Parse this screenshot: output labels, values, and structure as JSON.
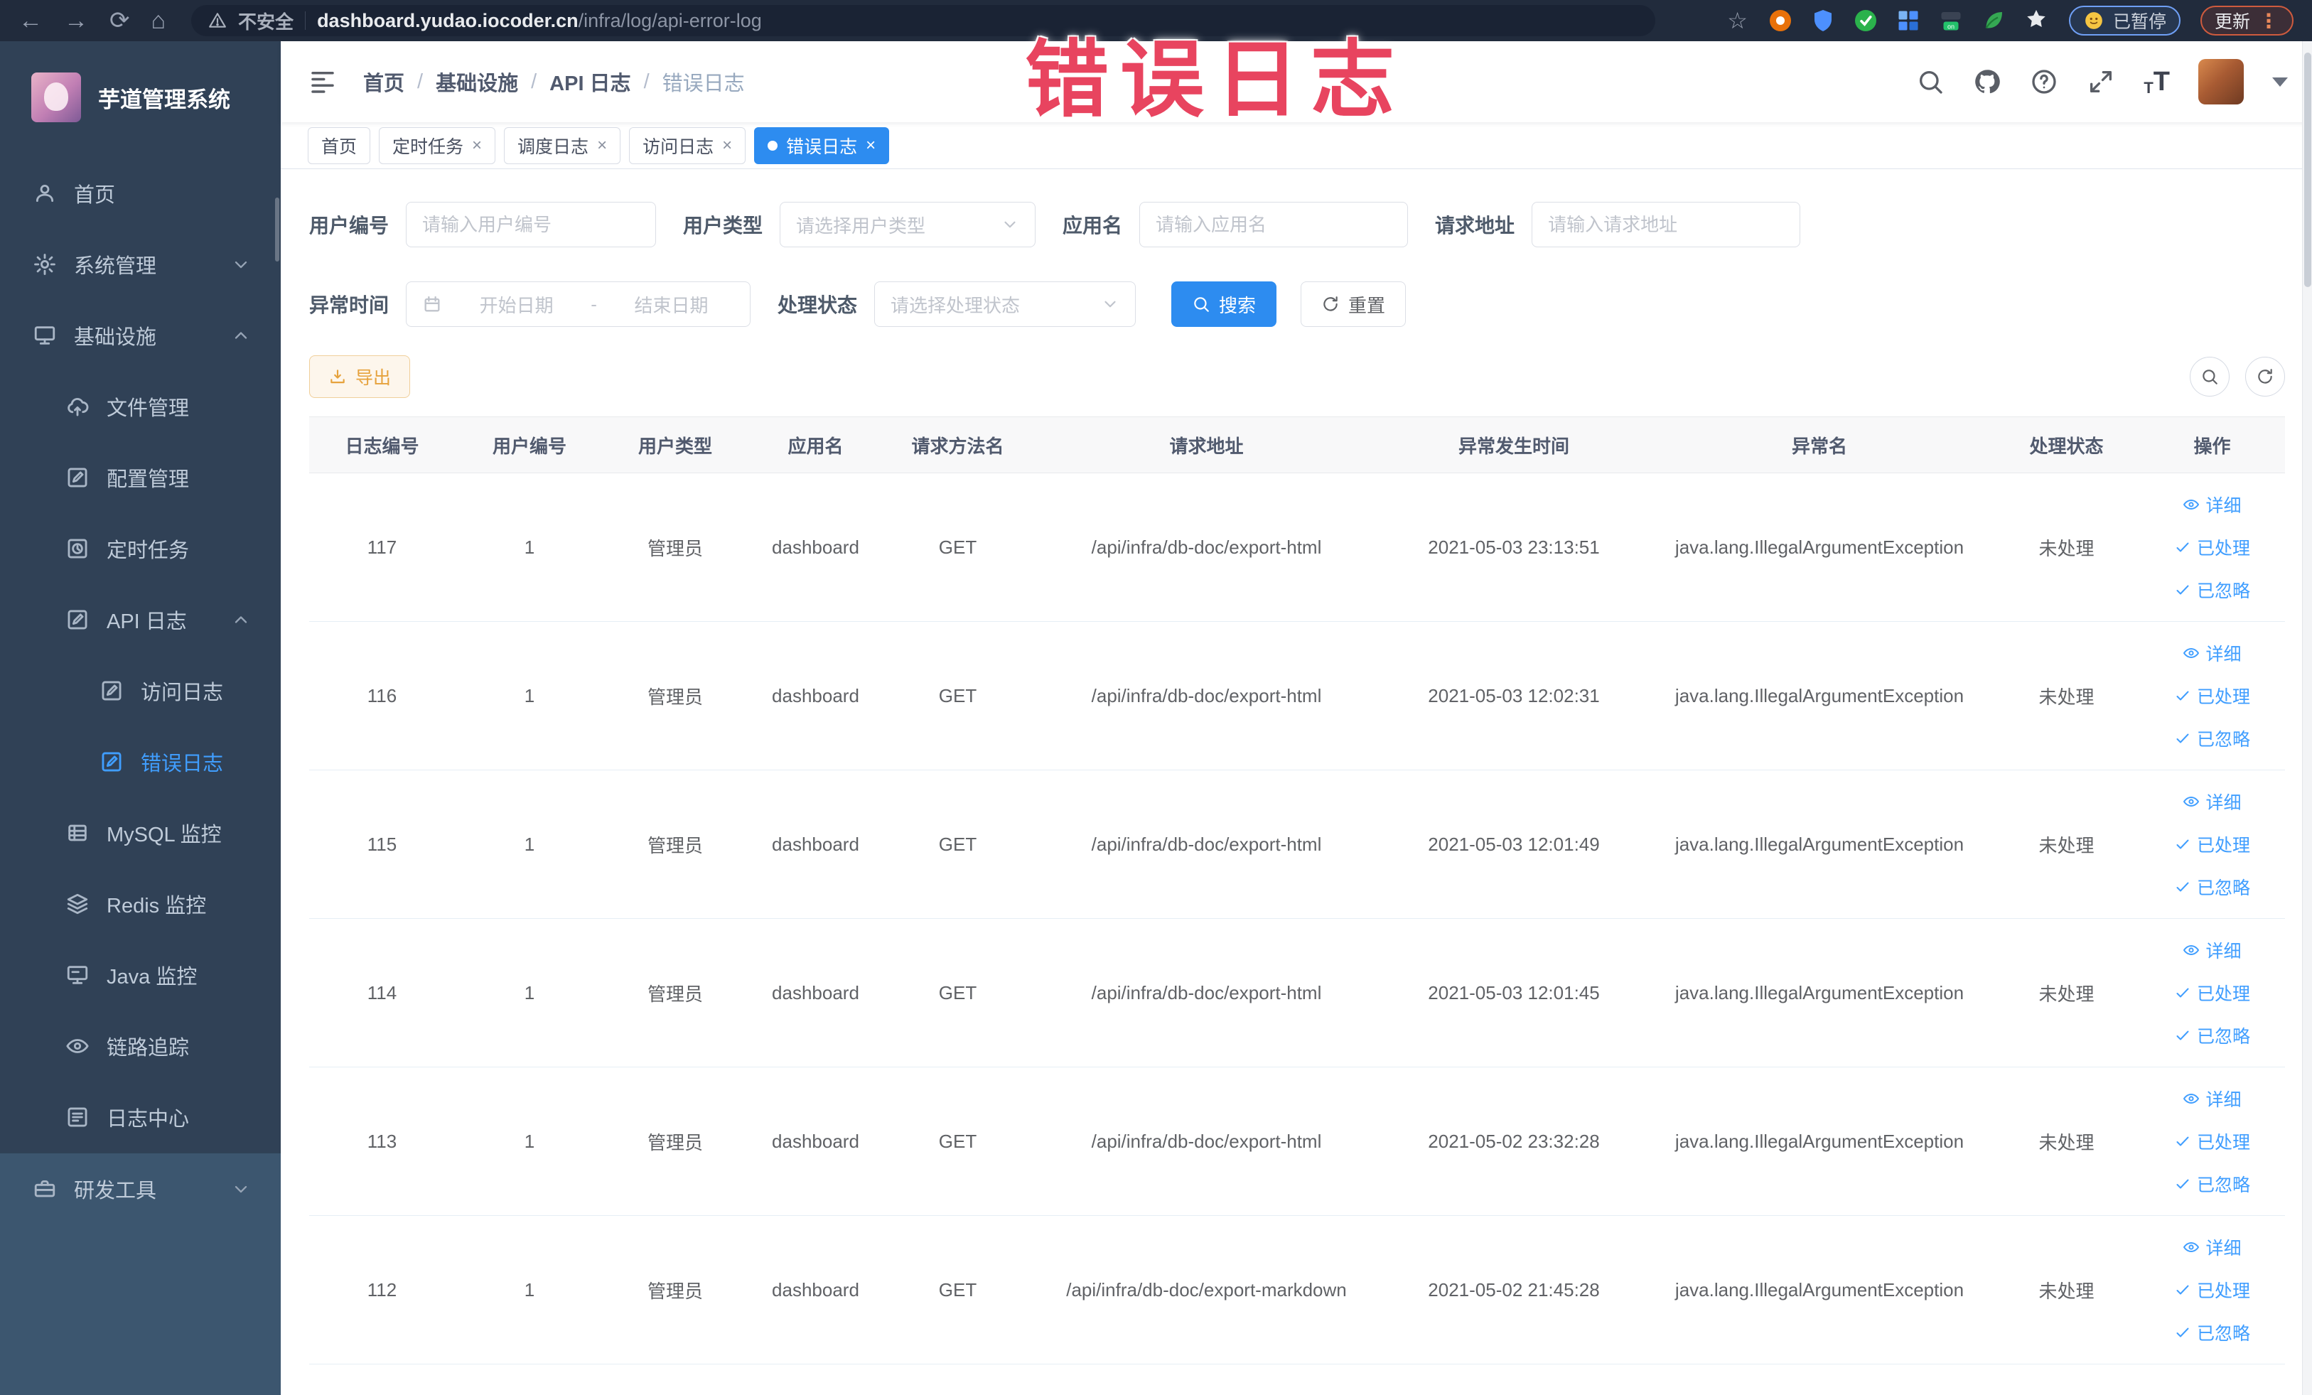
{
  "watermark": "错误日志",
  "colors": {
    "accent": "#409eff",
    "primary_button": "#2d8cf0",
    "warning": "#e6a23c",
    "sidebar_bg": "#304156",
    "watermark_pink": "#e8445f",
    "active_tab": "#2d8cf0"
  },
  "browser": {
    "security_label": "不安全",
    "url_domain": "dashboard.yudao.iocoder.cn",
    "url_path": "/infra/log/api-error-log",
    "paused_badge": "已暂停",
    "update_button": "更新",
    "extensions": [
      "extension-rss-icon",
      "extension-shield-icon",
      "extension-check-circle-icon",
      "extension-grid-icon",
      "extension-switch-on-icon",
      "extension-leaf-icon",
      "extension-star-icon"
    ]
  },
  "sidebar": {
    "title": "芋道管理系统",
    "menu": [
      {
        "key": "home",
        "label": "首页",
        "icon": "home-icon",
        "level": 0
      },
      {
        "key": "system-management",
        "label": "系统管理",
        "icon": "gear-icon",
        "level": 0,
        "chevron": "down"
      },
      {
        "key": "infrastructure",
        "label": "基础设施",
        "icon": "monitor-icon",
        "level": 0,
        "chevron": "up"
      },
      {
        "key": "file-management",
        "label": "文件管理",
        "icon": "cloud-upload-icon",
        "level": 1
      },
      {
        "key": "config-management",
        "label": "配置管理",
        "icon": "edit-icon",
        "level": 1
      },
      {
        "key": "scheduled-tasks",
        "label": "定时任务",
        "icon": "schedule-icon",
        "level": 1
      },
      {
        "key": "api-logs",
        "label": "API 日志",
        "icon": "log-icon",
        "level": 1,
        "chevron": "up"
      },
      {
        "key": "access-logs",
        "label": "访问日志",
        "icon": "log-icon",
        "level": 2
      },
      {
        "key": "error-logs",
        "label": "错误日志",
        "icon": "log-icon",
        "level": 2,
        "active": true
      },
      {
        "key": "mysql-monitor",
        "label": "MySQL 监控",
        "icon": "database-icon",
        "level": 1
      },
      {
        "key": "redis-monitor",
        "label": "Redis 监控",
        "icon": "layers-icon",
        "level": 1
      },
      {
        "key": "java-monitor",
        "label": "Java 监控",
        "icon": "java-monitor-icon",
        "level": 1
      },
      {
        "key": "trace",
        "label": "链路追踪",
        "icon": "eye-icon",
        "level": 1
      },
      {
        "key": "log-center",
        "label": "日志中心",
        "icon": "log-center-icon",
        "level": 1
      },
      {
        "key": "dev-tools",
        "label": "研发工具",
        "icon": "toolbox-icon",
        "level": 0,
        "chevron": "down",
        "bottom_section": true
      }
    ]
  },
  "navbar": {
    "breadcrumb": [
      "首页",
      "基础设施",
      "API 日志",
      "错误日志"
    ]
  },
  "tabs": [
    {
      "label": "首页",
      "closable": false,
      "active": false
    },
    {
      "label": "定时任务",
      "closable": true,
      "active": false
    },
    {
      "label": "调度日志",
      "closable": true,
      "active": false
    },
    {
      "label": "访问日志",
      "closable": true,
      "active": false
    },
    {
      "label": "错误日志",
      "closable": true,
      "active": true
    }
  ],
  "filters": {
    "user_id": {
      "label": "用户编号",
      "placeholder": "请输入用户编号"
    },
    "user_type": {
      "label": "用户类型",
      "placeholder": "请选择用户类型"
    },
    "app_name": {
      "label": "应用名",
      "placeholder": "请输入应用名"
    },
    "request_url": {
      "label": "请求地址",
      "placeholder": "请输入请求地址"
    },
    "exception_time": {
      "label": "异常时间",
      "start_placeholder": "开始日期",
      "separator": "-",
      "end_placeholder": "结束日期"
    },
    "process_status": {
      "label": "处理状态",
      "placeholder": "请选择处理状态"
    },
    "search_button": "搜索",
    "reset_button": "重置"
  },
  "toolbar": {
    "export_button": "导出"
  },
  "table": {
    "columns": [
      "日志编号",
      "用户编号",
      "用户类型",
      "应用名",
      "请求方法名",
      "请求地址",
      "异常发生时间",
      "异常名",
      "处理状态",
      "操作"
    ],
    "row_actions": [
      "详细",
      "已处理",
      "已忽略"
    ],
    "rows": [
      {
        "id": "117",
        "user_id": "1",
        "user_type": "管理员",
        "app": "dashboard",
        "method": "GET",
        "url": "/api/infra/db-doc/export-html",
        "time": "2021-05-03 23:13:51",
        "exception": "java.lang.IllegalArgumentException",
        "status": "未处理"
      },
      {
        "id": "116",
        "user_id": "1",
        "user_type": "管理员",
        "app": "dashboard",
        "method": "GET",
        "url": "/api/infra/db-doc/export-html",
        "time": "2021-05-03 12:02:31",
        "exception": "java.lang.IllegalArgumentException",
        "status": "未处理"
      },
      {
        "id": "115",
        "user_id": "1",
        "user_type": "管理员",
        "app": "dashboard",
        "method": "GET",
        "url": "/api/infra/db-doc/export-html",
        "time": "2021-05-03 12:01:49",
        "exception": "java.lang.IllegalArgumentException",
        "status": "未处理"
      },
      {
        "id": "114",
        "user_id": "1",
        "user_type": "管理员",
        "app": "dashboard",
        "method": "GET",
        "url": "/api/infra/db-doc/export-html",
        "time": "2021-05-03 12:01:45",
        "exception": "java.lang.IllegalArgumentException",
        "status": "未处理"
      },
      {
        "id": "113",
        "user_id": "1",
        "user_type": "管理员",
        "app": "dashboard",
        "method": "GET",
        "url": "/api/infra/db-doc/export-html",
        "time": "2021-05-02 23:32:28",
        "exception": "java.lang.IllegalArgumentException",
        "status": "未处理"
      },
      {
        "id": "112",
        "user_id": "1",
        "user_type": "管理员",
        "app": "dashboard",
        "method": "GET",
        "url": "/api/infra/db-doc/export-markdown",
        "time": "2021-05-02 21:45:28",
        "exception": "java.lang.IllegalArgumentException",
        "status": "未处理"
      }
    ]
  }
}
